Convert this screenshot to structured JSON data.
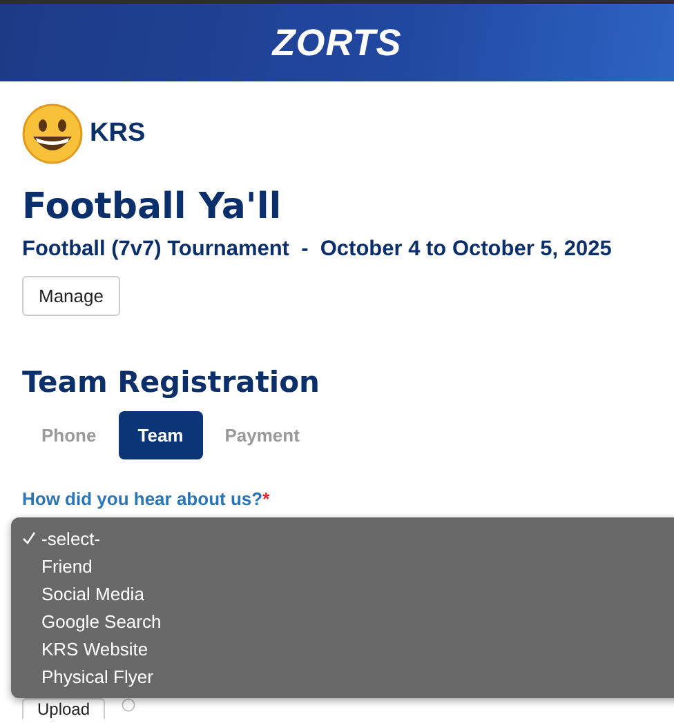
{
  "header": {
    "logo": "ZORTS"
  },
  "organizer": {
    "name": "KRS"
  },
  "event": {
    "title": "Football Ya'll",
    "subtitle": "Football (7v7) Tournament  -  October 4 to October 5, 2025",
    "manage_button": "Manage"
  },
  "section": {
    "title": "Team Registration"
  },
  "tabs": [
    {
      "label": "Phone",
      "selected": false
    },
    {
      "label": "Team",
      "selected": true
    },
    {
      "label": "Payment",
      "selected": false
    }
  ],
  "question": {
    "label": "How did you hear about us?",
    "required": true,
    "required_mark": "*"
  },
  "dropdown": {
    "options": [
      {
        "label": "-select-",
        "selected": true
      },
      {
        "label": "Friend",
        "selected": false
      },
      {
        "label": "Social Media",
        "selected": false
      },
      {
        "label": "Google Search",
        "selected": false
      },
      {
        "label": "KRS Website",
        "selected": false
      },
      {
        "label": "Physical Flyer",
        "selected": false
      }
    ]
  },
  "upload_button": "Upload"
}
